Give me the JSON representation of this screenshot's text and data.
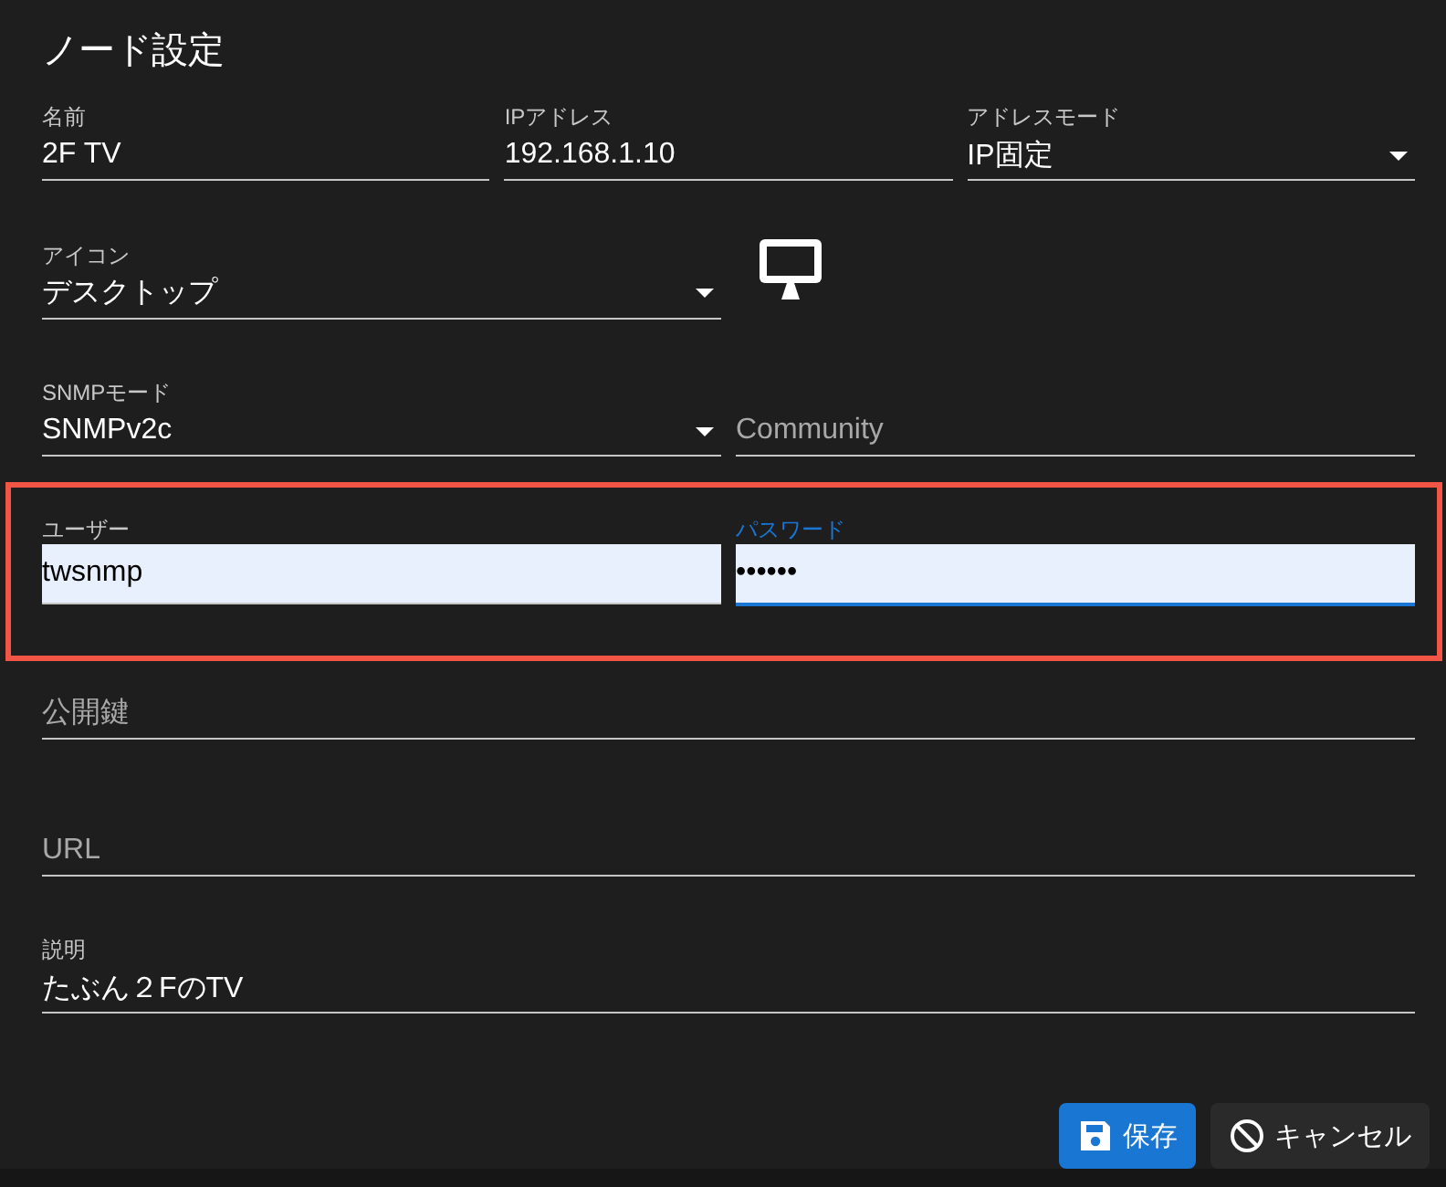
{
  "title": "ノード設定",
  "rows": [
    {
      "highlighted": false,
      "items": [
        {
          "kind": "text",
          "label": "名前",
          "value": "2F TV",
          "focused": false,
          "autofilled": false
        },
        {
          "kind": "text",
          "label": "IPアドレス",
          "value": "192.168.1.10",
          "focused": false,
          "autofilled": false
        },
        {
          "kind": "select",
          "label": "アドレスモード",
          "value": "IP固定",
          "focused": false,
          "autofilled": false
        }
      ]
    },
    {
      "highlighted": false,
      "items": [
        {
          "kind": "select",
          "label": "アイコン",
          "value": "デスクトップ",
          "focused": false,
          "autofilled": false
        },
        {
          "kind": "icon"
        }
      ]
    },
    {
      "highlighted": false,
      "items": [
        {
          "kind": "select",
          "label": "SNMPモード",
          "value": "SNMPv2c",
          "focused": false,
          "autofilled": false
        },
        {
          "kind": "text",
          "placeholder": "Community",
          "focused": false,
          "autofilled": false
        }
      ]
    },
    {
      "highlighted": true,
      "items": [
        {
          "kind": "text",
          "label": "ユーザー",
          "value": "twsnmp",
          "focused": false,
          "autofilled": true
        },
        {
          "kind": "text",
          "label": "パスワード",
          "value": "••••••",
          "focused": true,
          "autofilled": true
        }
      ]
    },
    {
      "highlighted": false,
      "items": [
        {
          "kind": "text",
          "placeholder": "公開鍵",
          "focused": false,
          "autofilled": false
        }
      ]
    },
    {
      "highlighted": false,
      "items": [
        {
          "kind": "text",
          "placeholder": "URL",
          "focused": false,
          "autofilled": false
        }
      ]
    },
    {
      "highlighted": false,
      "items": [
        {
          "kind": "text",
          "label": "説明",
          "value": "たぶん２FのTV",
          "focused": false,
          "autofilled": false
        }
      ]
    }
  ],
  "buttons": [
    {
      "kind": "primary",
      "label": "保存"
    },
    {
      "kind": "secondary",
      "label": "キャンセル"
    }
  ]
}
